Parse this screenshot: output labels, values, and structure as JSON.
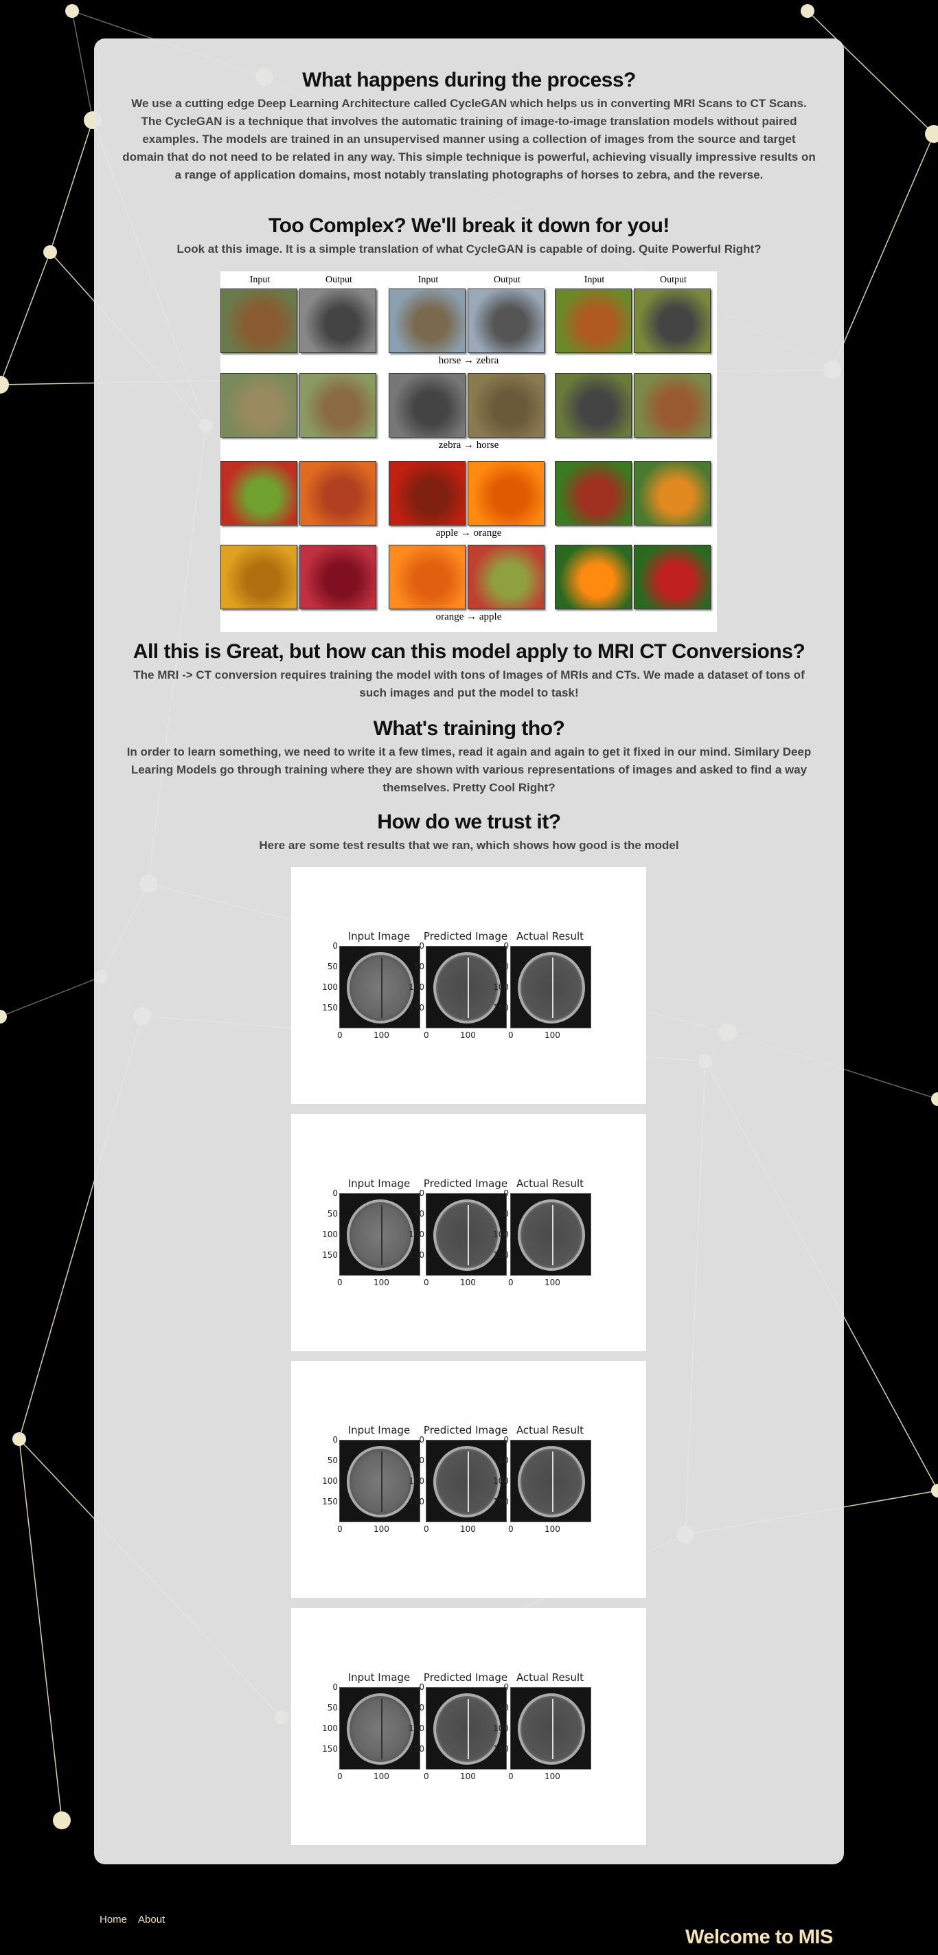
{
  "sections": [
    {
      "heading": "What happens during the process?",
      "text": "We use a cutting edge Deep Learning Architecture called CycleGAN which helps us in converting MRI Scans to CT Scans. The CycleGAN is a technique that involves the automatic training of image-to-image translation models without paired examples. The models are trained in an unsupervised manner using a collection of images from the source and target domain that do not need to be related in any way. This simple technique is powerful, achieving visually impressive results on a range of application domains, most notably translating photographs of horses to zebra, and the reverse."
    },
    {
      "heading": "Too Complex? We'll break it down for you!",
      "text": "Look at this image. It is a simple translation of what CycleGAN is capable of doing. Quite Powerful Right?"
    },
    {
      "heading": "All this is Great, but how can this model apply to MRI CT Conversions?",
      "text": "The MRI -> CT conversion requires training the model with tons of Images of MRIs and CTs. We made a dataset of tons of such images and put the model to task!"
    },
    {
      "heading": "What's training tho?",
      "text": "In order to learn something, we need to write it a few times, read it again and again to get it fixed in our mind. Similary Deep Learing Models go through training where they are shown with various representations of images and asked to find a way themselves. Pretty Cool Right?"
    },
    {
      "heading": "How do we trust it?",
      "text": "Here are some test results that we ran, which shows how good is the model"
    }
  ],
  "cyclegan_figure": {
    "input_label": "Input",
    "output_label": "Output",
    "captions": [
      "horse → zebra",
      "zebra → horse",
      "apple → orange",
      "orange → apple"
    ]
  },
  "results": {
    "titles": [
      "Input Image",
      "Predicted Image",
      "Actual Result"
    ],
    "y_ticks": [
      "0",
      "50",
      "100",
      "150"
    ],
    "x_ticks": [
      "0",
      "100"
    ],
    "count": 4
  },
  "footer": {
    "links": [
      "Home",
      "About"
    ],
    "welcome": "Welcome to MIS"
  },
  "colors": {
    "accent": "#f5e3b3",
    "card": "#e4e4e4"
  }
}
